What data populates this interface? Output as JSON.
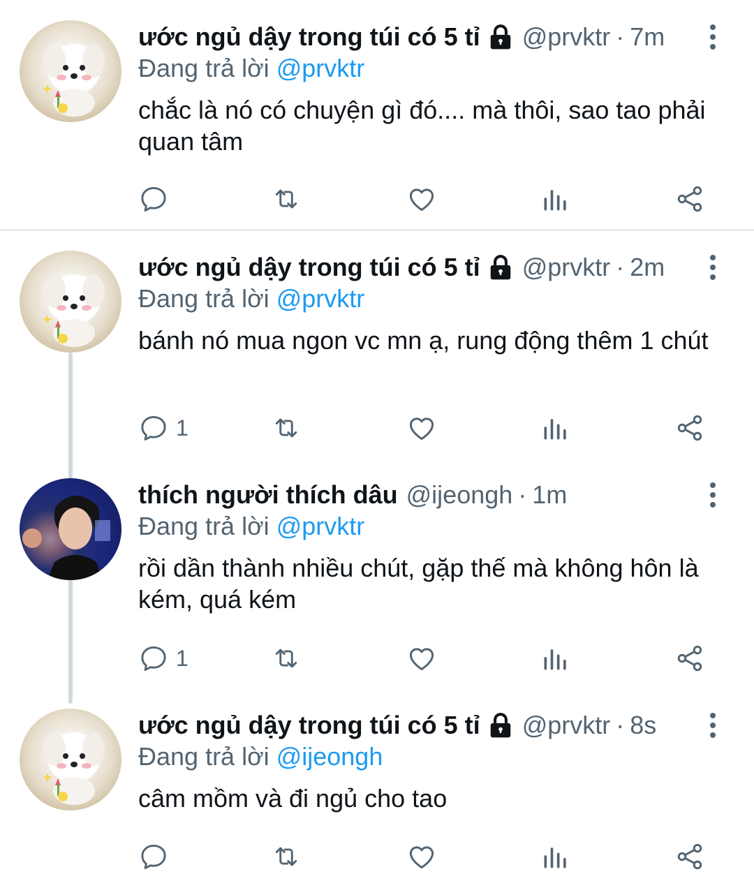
{
  "tweets": [
    {
      "name": "ước ngủ dậy trong túi có 5 tỉ",
      "handle": "@prvktr",
      "sep": "·",
      "time": "7m",
      "replying_prefix": "Đang trả lời",
      "replying_to": "@prvktr",
      "text": "chắc là nó có chuyện gì đó.... mà thôi, sao tao phải quan tâm",
      "reply_count": ""
    },
    {
      "name": "ước ngủ dậy trong túi có 5 tỉ",
      "handle": "@prvktr",
      "sep": "·",
      "time": "2m",
      "replying_prefix": "Đang trả lời",
      "replying_to": "@prvktr",
      "text": "bánh nó mua ngon vc mn ạ, rung động thêm 1 chút",
      "reply_count": "1"
    },
    {
      "name": "thích người thích dâu",
      "handle": "@ijeongh",
      "sep": "·",
      "time": "1m",
      "replying_prefix": "Đang trả lời",
      "replying_to": "@prvktr",
      "text": "rồi dần thành nhiều chút, gặp thế mà không hôn là kém, quá kém",
      "reply_count": "1"
    },
    {
      "name": "ước ngủ dậy trong túi có 5 tỉ",
      "handle": "@prvktr",
      "sep": "·",
      "time": "8s",
      "replying_prefix": "Đang trả lời",
      "replying_to": "@ijeongh",
      "text": "câm mồm và đi ngủ cho tao",
      "reply_count": ""
    }
  ],
  "icons": {
    "lock": "lock-icon",
    "more": "more-vertical-icon",
    "reply": "reply-icon",
    "retweet": "retweet-icon",
    "like": "heart-icon",
    "views": "views-icon",
    "share": "share-icon"
  },
  "colors": {
    "text": "#0f1419",
    "secondary": "#536471",
    "link": "#1d9bf0",
    "thread_line": "#cfd9de"
  }
}
